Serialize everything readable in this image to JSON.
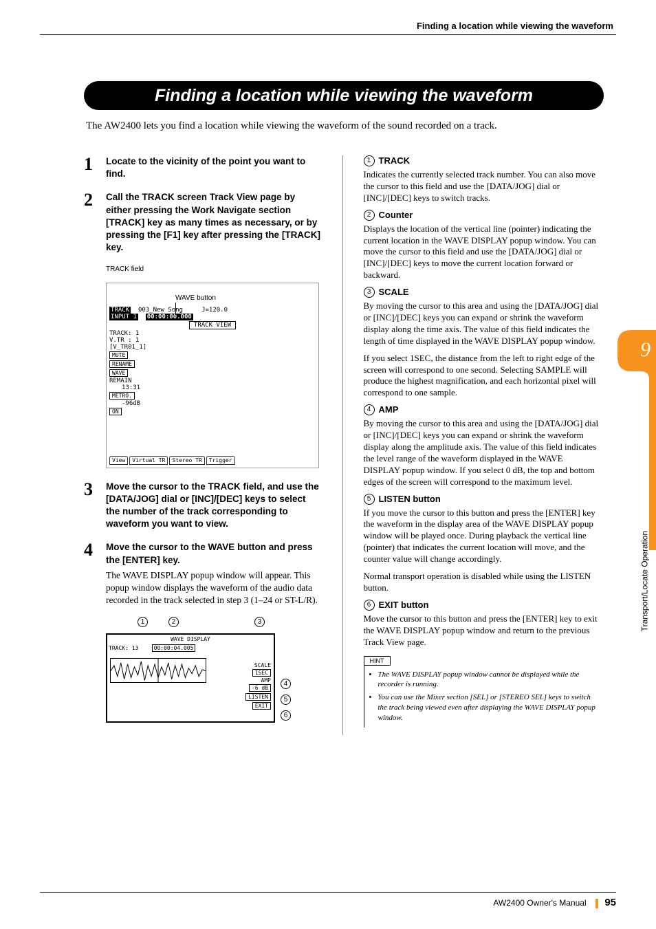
{
  "header": {
    "running_title": "Finding a location while viewing the waveform"
  },
  "title": "Finding a location while viewing the waveform",
  "intro": "The AW2400 lets you find a location while viewing the waveform of the sound recorded on a track.",
  "steps": [
    {
      "num": "1",
      "head": "Locate to the vicinity of the point you want to find.",
      "body": ""
    },
    {
      "num": "2",
      "head": "Call the TRACK screen Track View page by either pressing the Work Navigate section [TRACK] key as many times as necessary, or by pressing the [F1] key after pressing the [TRACK] key.",
      "body": ""
    },
    {
      "num": "3",
      "head": "Move the cursor to the TRACK field, and use the [DATA/JOG] dial or [INC]/[DEC] keys to select the number of the track corresponding to waveform you want to view.",
      "body": ""
    },
    {
      "num": "4",
      "head": "Move the cursor to the WAVE button and press the [ENTER] key.",
      "body": "The WAVE DISPLAY popup window will appear. This popup window displays the waveform of the audio data recorded in the track selected in step 3 (1–24 or ST-L/R)."
    }
  ],
  "labels": {
    "track_field": "TRACK field",
    "wave_button": "WAVE button"
  },
  "track_view": {
    "title_left": "TRACK",
    "input": "INPUT 1",
    "song": "003_New Song",
    "counter": "00:00:00.000",
    "tempo": "J=120.0",
    "section_label": "TRACK VIEW",
    "fields": [
      "TRACK:  1",
      "V.TR :  1",
      "[V_TR01_1]"
    ],
    "buttons": [
      "MUTE",
      "RENAME",
      "WAVE"
    ],
    "remain": "REMAIN",
    "remain_time": "13:31",
    "metro": "METRO.",
    "db": "-96dB",
    "on": "ON",
    "tabs": [
      "View",
      "Virtual TR",
      "Stereo TR",
      "Trigger"
    ]
  },
  "wave_popup": {
    "title": "WAVE DISPLAY",
    "track": "TRACK:  13",
    "counter": "00:00:04.005",
    "scale_label": "SCALE",
    "scale_value": "1SEC",
    "amp_label": "AMP",
    "amp_value": "-6 dB",
    "listen": "LISTEN",
    "exit": "EXIT"
  },
  "items": [
    {
      "num": "1",
      "title": "TRACK",
      "body": "Indicates the currently selected track number. You can also move the cursor to this field and use the [DATA/JOG] dial or [INC]/[DEC] keys to switch tracks."
    },
    {
      "num": "2",
      "title": "Counter",
      "body": "Displays the location of the vertical line (pointer) indicating the current location in the WAVE DISPLAY popup window. You can move the cursor to this field and use the [DATA/JOG] dial or [INC]/[DEC] keys to move the current location forward or backward."
    },
    {
      "num": "3",
      "title": "SCALE",
      "body": "By moving the cursor to this area and using the [DATA/JOG] dial or [INC]/[DEC] keys you can expand or shrink the waveform display along the time axis. The value of this field indicates the length of time displayed in the WAVE DISPLAY popup window.",
      "body2": "If you select 1SEC, the distance from the left to right edge of the screen will correspond to one second. Selecting SAMPLE will produce the highest magnification, and each horizontal pixel will correspond to one sample."
    },
    {
      "num": "4",
      "title": "AMP",
      "body": "By moving the cursor to this area and using the [DATA/JOG] dial or [INC]/[DEC] keys you can expand or shrink the waveform display along the amplitude axis. The value of this field indicates the level range of the waveform displayed in the WAVE DISPLAY popup window. If you select 0 dB, the top and bottom edges of the screen will correspond to the maximum level."
    },
    {
      "num": "5",
      "title": "LISTEN button",
      "body": "If you move the cursor to this button and press the [ENTER] key the waveform in the display area of the WAVE DISPLAY popup window will be played once. During playback the vertical line (pointer) that indicates the current location will move, and the counter value will change accordingly.",
      "body2": "Normal transport operation is disabled while using the LISTEN button."
    },
    {
      "num": "6",
      "title": "EXIT button",
      "body": "Move the cursor to this button and press the [ENTER] key to exit the WAVE DISPLAY popup window and return to the previous Track View page."
    }
  ],
  "hint": {
    "label": "HINT",
    "items": [
      "The WAVE DISPLAY popup window cannot be displayed while the recorder is running.",
      "You can use the Mixer section [SEL] or [STEREO SEL] keys to switch the track being viewed even after displaying the WAVE DISPLAY popup window."
    ]
  },
  "side": {
    "chapter": "9",
    "text": "Transport/Locate Operation"
  },
  "footer": {
    "manual": "AW2400  Owner's Manual",
    "page": "95"
  }
}
